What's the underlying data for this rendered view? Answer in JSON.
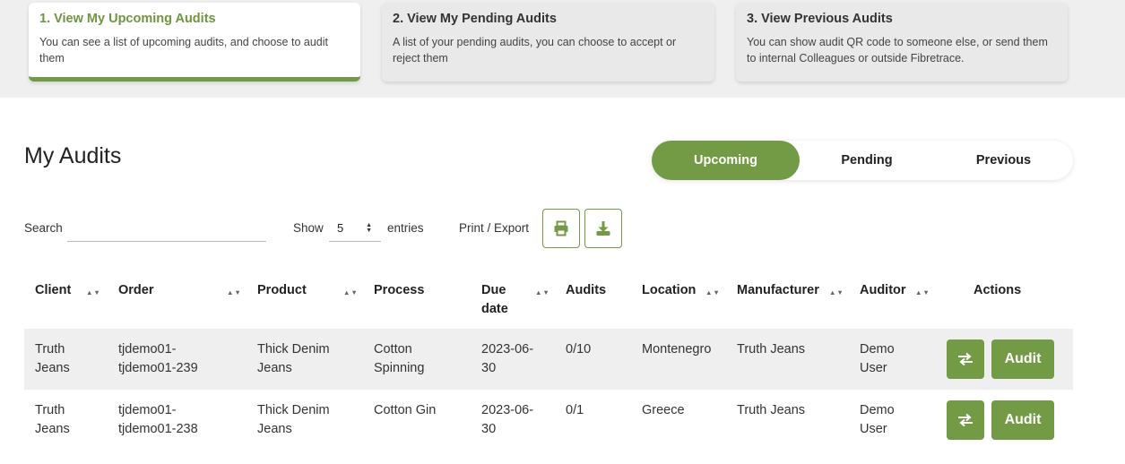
{
  "steps": [
    {
      "title": "1. View My Upcoming Audits",
      "desc": "You can see a list of upcoming audits, and choose to audit them"
    },
    {
      "title": "2. View My Pending Audits",
      "desc": "A list of your pending audits, you can choose to accept or reject them"
    },
    {
      "title": "3. View Previous Audits",
      "desc": "You can show audit QR code to someone else, or send them to internal Colleagues or outside Fibretrace."
    }
  ],
  "page_title": "My Audits",
  "tabs": [
    {
      "label": "Upcoming",
      "active": true
    },
    {
      "label": "Pending",
      "active": false
    },
    {
      "label": "Previous",
      "active": false
    }
  ],
  "controls": {
    "search_label": "Search",
    "search_value": "",
    "show_label": "Show",
    "entries_value": "5",
    "entries_label": "entries",
    "print_export_label": "Print / Export"
  },
  "icons": {
    "print": "printer-icon",
    "download": "download-icon",
    "swap": "swap-arrows-icon"
  },
  "accent_color": "#739a45",
  "table": {
    "columns": [
      "Client",
      "Order",
      "Product",
      "Process",
      "Due date",
      "Audits",
      "Location",
      "Manufacturer",
      "Auditor",
      "Actions"
    ],
    "rows": [
      {
        "client": "Truth Jeans",
        "order": "tjdemo01-tjdemo01-239",
        "product": "Thick Denim Jeans",
        "process": "Cotton Spinning",
        "due": "2023-06-30",
        "audits": "0/10",
        "location": "Montenegro",
        "manufacturer": "Truth Jeans",
        "auditor": "Demo User",
        "action_label": "Audit"
      },
      {
        "client": "Truth Jeans",
        "order": "tjdemo01-tjdemo01-238",
        "product": "Thick Denim Jeans",
        "process": "Cotton Gin",
        "due": "2023-06-30",
        "audits": "0/1",
        "location": "Greece",
        "manufacturer": "Truth Jeans",
        "auditor": "Demo User",
        "action_label": "Audit"
      }
    ]
  }
}
